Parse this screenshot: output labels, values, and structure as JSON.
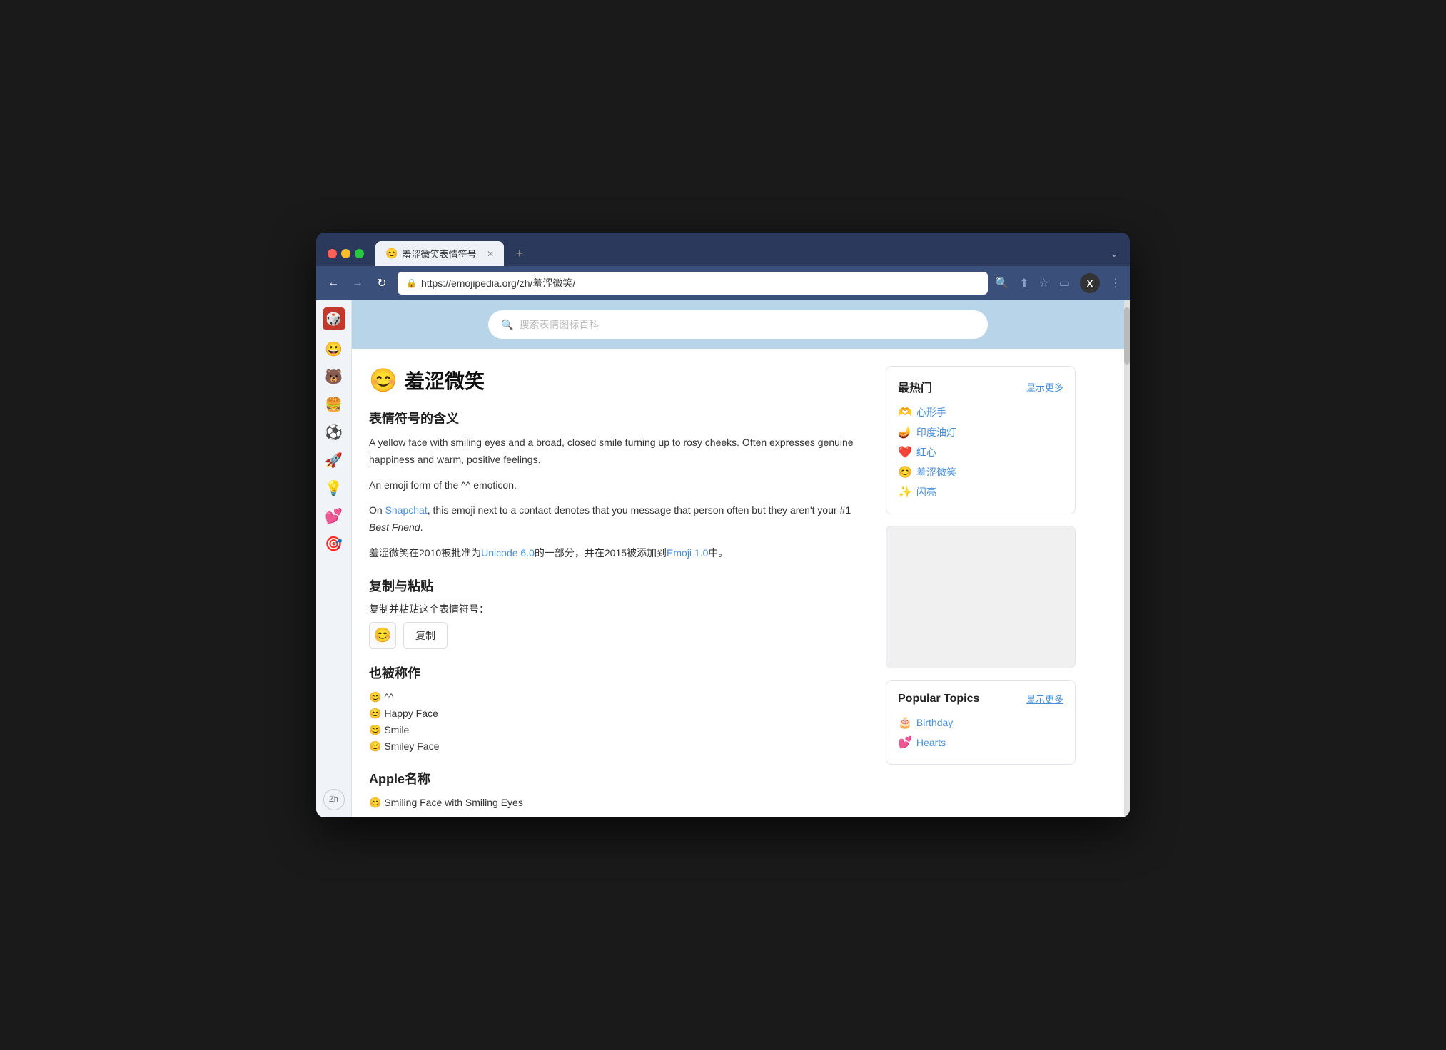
{
  "browser": {
    "tab": {
      "favicon": "😊",
      "title": "羞涩微笑表情符号",
      "close": "✕"
    },
    "tab_new": "+",
    "tab_chevron": "⌄",
    "address": "https://emojipedia.org/zh/羞涩微笑/",
    "lock_icon": "🔒",
    "nav": {
      "back": "←",
      "forward": "→",
      "refresh": "↻"
    },
    "toolbar": {
      "search": "🔍",
      "share": "⬆",
      "bookmark": "☆",
      "sidebar": "▭",
      "x_label": "X",
      "menu": "⋮"
    }
  },
  "left_sidebar": {
    "logo_emoji": "🎲",
    "items": [
      {
        "emoji": "😀",
        "name": "smiley"
      },
      {
        "emoji": "🐻",
        "name": "bear"
      },
      {
        "emoji": "🍔",
        "name": "burger"
      },
      {
        "emoji": "⚽",
        "name": "soccer"
      },
      {
        "emoji": "🚀",
        "name": "rocket"
      },
      {
        "emoji": "💡",
        "name": "bulb"
      },
      {
        "emoji": "💕",
        "name": "hearts"
      },
      {
        "emoji": "🎯",
        "name": "target"
      }
    ],
    "lang": "Zh"
  },
  "search": {
    "placeholder": "搜索表情图标百科"
  },
  "article": {
    "emoji": "😊",
    "title": "羞涩微笑",
    "meaning_title": "表情符号的含义",
    "description1": "A yellow face with smiling eyes and a broad, closed smile turning up to rosy cheeks. Often expresses genuine happiness and warm, positive feelings.",
    "description2": "An emoji form of the ^^ emoticon.",
    "description3_prefix": "On ",
    "snapchat_link": "Snapchat",
    "description3_suffix": ", this emoji next to a contact denotes that you message that person often but they aren't your #1 ",
    "best_friend": "Best Friend",
    "description3_end": ".",
    "description4_prefix": "羞涩微笑在2010被批准为",
    "unicode_link": "Unicode 6.0",
    "description4_mid": "的一部分，并在2015被添加到",
    "emoji_link": "Emoji 1.0",
    "description4_end": "中。",
    "copy_title": "复制与粘贴",
    "copy_label": "复制并粘贴这个表情符号：",
    "copy_emoji": "😊",
    "copy_btn": "复制",
    "also_known_title": "也被称作",
    "also_known_items": [
      {
        "emoji": "😊",
        "text": "^^"
      },
      {
        "emoji": "😊",
        "text": "Happy Face"
      },
      {
        "emoji": "😊",
        "text": "Smile"
      },
      {
        "emoji": "😊",
        "text": "Smiley Face"
      }
    ],
    "apple_title": "Apple名称",
    "apple_items": [
      {
        "emoji": "😊",
        "text": "Smiling Face with Smiling Eyes"
      }
    ]
  },
  "right_sidebar": {
    "popular_title": "最热门",
    "popular_show_more": "显示更多",
    "popular_items": [
      {
        "emoji": "🫶",
        "text": "心形手"
      },
      {
        "emoji": "🪔",
        "text": "印度油灯"
      },
      {
        "emoji": "❤️",
        "text": "红心"
      },
      {
        "emoji": "😊",
        "text": "羞涩微笑"
      },
      {
        "emoji": "✨",
        "text": "闪亮"
      }
    ],
    "topics_title": "Popular Topics",
    "topics_show_more": "显示更多",
    "topics_items": [
      {
        "emoji": "🎂",
        "text": "Birthday"
      },
      {
        "emoji": "💕",
        "text": "Hearts"
      }
    ]
  }
}
